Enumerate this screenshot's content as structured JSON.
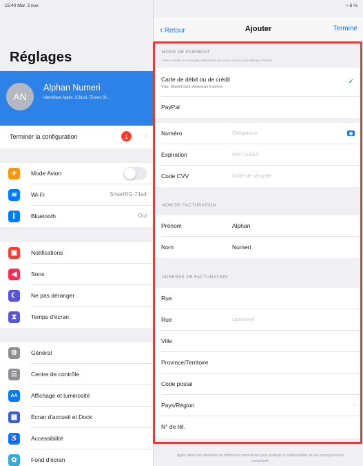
{
  "status": {
    "time_date": "15:40  Mar. 3 nov.",
    "battery": "≈ 6 %"
  },
  "sidebar": {
    "title": "Réglages",
    "profile": {
      "initials": "AN",
      "name": "Alphan Numeri",
      "subtitle": "Identifiant Apple, iCloud, iTunes St..."
    },
    "setup": {
      "label": "Terminer la configuration",
      "badge": "1"
    },
    "group1": [
      {
        "label": "Mode Avion",
        "value": "",
        "icon": "airplane-icon",
        "color": "#ff9500"
      },
      {
        "label": "Wi-Fi",
        "value": "SmartRG-74a4",
        "icon": "wifi-icon",
        "color": "#007aff"
      },
      {
        "label": "Bluetooth",
        "value": "Oui",
        "icon": "bluetooth-icon",
        "color": "#007aff"
      }
    ],
    "group2": [
      {
        "label": "Notifications",
        "icon": "notifications-icon",
        "color": "#ff3b30"
      },
      {
        "label": "Sons",
        "icon": "sounds-icon",
        "color": "#ff2d55"
      },
      {
        "label": "Ne pas déranger",
        "icon": "moon-icon",
        "color": "#5856d6"
      },
      {
        "label": "Temps d'écran",
        "icon": "hourglass-icon",
        "color": "#5856d6"
      }
    ],
    "group3": [
      {
        "label": "Général",
        "icon": "gear-icon",
        "color": "#8e8e93"
      },
      {
        "label": "Centre de contrôle",
        "icon": "control-center-icon",
        "color": "#8e8e93"
      },
      {
        "label": "Affichage et luminosité",
        "icon": "display-icon",
        "color": "#007aff"
      },
      {
        "label": "Écran d'accueil et Dock",
        "icon": "home-screen-icon",
        "color": "#3a5fcd"
      },
      {
        "label": "Accessibilité",
        "icon": "accessibility-icon",
        "color": "#007aff"
      },
      {
        "label": "Fond d'écran",
        "icon": "wallpaper-icon",
        "color": "#34aadc"
      }
    ]
  },
  "nav": {
    "back": "Retour",
    "title": "Ajouter",
    "done": "Terminé"
  },
  "payment": {
    "header": "MODE DE PAIEMENT",
    "note": "Votre compte ne sera pas débité tant que vous n'aurez pas effectué d'achat.",
    "card_label": "Carte de débit ou de crédit",
    "card_sub": "Visa, MasterCard, American Express",
    "paypal": "PayPal",
    "fields": [
      {
        "label": "Numéro",
        "placeholder": "Obligatoire"
      },
      {
        "label": "Expiration",
        "placeholder": "MM / AAAA"
      },
      {
        "label": "Code CVV",
        "placeholder": "Code de sécurité"
      }
    ]
  },
  "billing_name": {
    "header": "NOM DE FACTURATION",
    "first_label": "Prénom",
    "first_value": "Alphan",
    "last_label": "Nom",
    "last_value": "Numeri"
  },
  "billing_address": {
    "header": "ADRESSE DE FACTURATION",
    "street1": "Rue",
    "street2": "Rue",
    "street2_placeholder": "Optionnel",
    "city": "Ville",
    "province": "Province/Territoire",
    "postal": "Code postal",
    "country": "Pays/Région",
    "phone": "N° de tél."
  },
  "footer": "Apple utilise des méthodes de chiffrement normalisées pour protéger la confidentialité de vos renseignements personnels."
}
